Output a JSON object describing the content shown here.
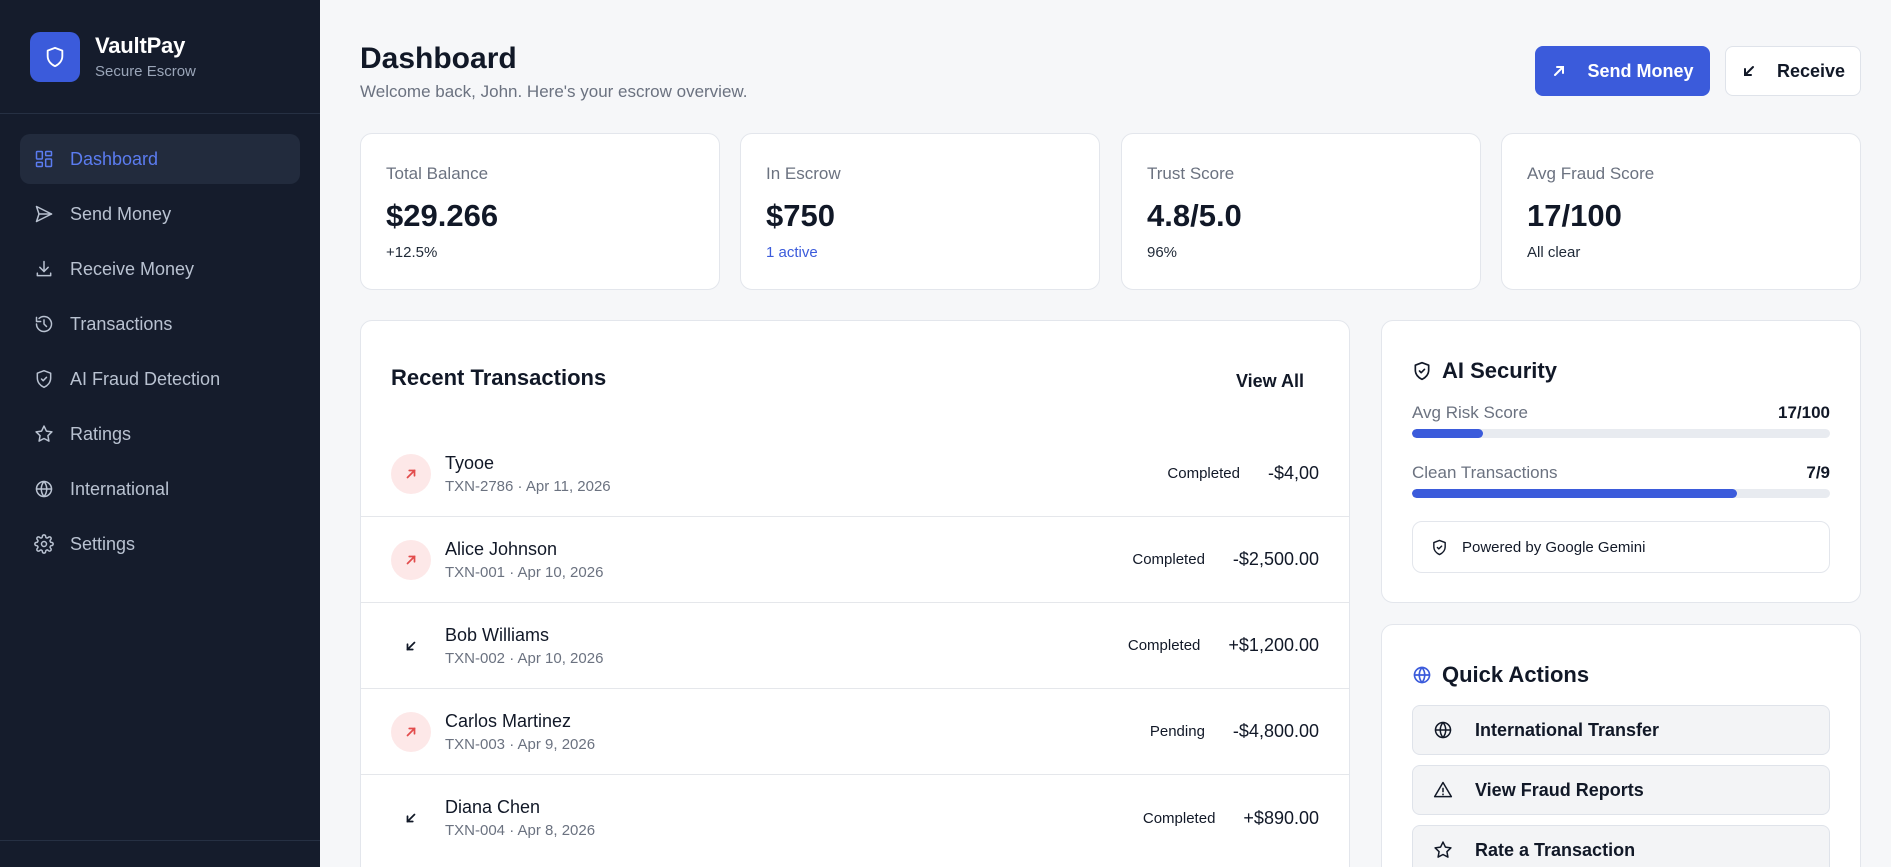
{
  "brand": {
    "name": "VaultPay",
    "subtitle": "Secure Escrow"
  },
  "sidebar": {
    "items": [
      {
        "label": "Dashboard",
        "icon": "grid-icon",
        "active": true
      },
      {
        "label": "Send Money",
        "icon": "send-icon"
      },
      {
        "label": "Receive Money",
        "icon": "download-icon"
      },
      {
        "label": "Transactions",
        "icon": "history-icon"
      },
      {
        "label": "AI Fraud Detection",
        "icon": "shield-icon"
      },
      {
        "label": "Ratings",
        "icon": "star-icon"
      },
      {
        "label": "International",
        "icon": "globe-icon"
      },
      {
        "label": "Settings",
        "icon": "gear-icon"
      }
    ]
  },
  "header": {
    "title": "Dashboard",
    "subtitle": "Welcome back, John. Here's your escrow overview.",
    "send_label": "Send Money",
    "receive_label": "Receive"
  },
  "stats": [
    {
      "label": "Total Balance",
      "value": "$29.266",
      "sub": "+12.5%"
    },
    {
      "label": "In Escrow",
      "value": "$750",
      "sub": "1 active"
    },
    {
      "label": "Trust Score",
      "value": "4.8/5.0",
      "sub": "96%"
    },
    {
      "label": "Avg Fraud Score",
      "value": "17/100",
      "sub": "All clear"
    }
  ],
  "transactions": {
    "title": "Recent Transactions",
    "view_all": "View All",
    "rows": [
      {
        "name": "Tyooe",
        "meta": "TXN-2786 · Apr 11, 2026",
        "status": "Completed",
        "amount": "-$4,00",
        "direction": "out"
      },
      {
        "name": "Alice Johnson",
        "meta": "TXN-001 · Apr 10, 2026",
        "status": "Completed",
        "amount": "-$2,500.00",
        "direction": "out"
      },
      {
        "name": "Bob Williams",
        "meta": "TXN-002 · Apr 10, 2026",
        "status": "Completed",
        "amount": "+$1,200.00",
        "direction": "in"
      },
      {
        "name": "Carlos Martinez",
        "meta": "TXN-003 · Apr 9, 2026",
        "status": "Pending",
        "amount": "-$4,800.00",
        "direction": "out"
      },
      {
        "name": "Diana Chen",
        "meta": "TXN-004 · Apr 8, 2026",
        "status": "Completed",
        "amount": "+$890.00",
        "direction": "in"
      }
    ]
  },
  "security": {
    "title": "AI Security",
    "avg_risk_label": "Avg Risk Score",
    "avg_risk_value": "17/100",
    "avg_risk_fraction": 0.17,
    "clean_label": "Clean Transactions",
    "clean_value": "7/9",
    "clean_fraction": 0.778,
    "powered_by": "Powered by Google Gemini"
  },
  "quick_actions": {
    "title": "Quick Actions",
    "items": [
      {
        "label": "International Transfer",
        "icon": "globe-icon"
      },
      {
        "label": "View Fraud Reports",
        "icon": "alert-triangle-icon"
      },
      {
        "label": "Rate a Transaction",
        "icon": "star-icon"
      }
    ]
  },
  "colors": {
    "accent": "#3b5bdb",
    "sidebar_bg": "#151c2c",
    "outgoing": "#e24c4c"
  }
}
